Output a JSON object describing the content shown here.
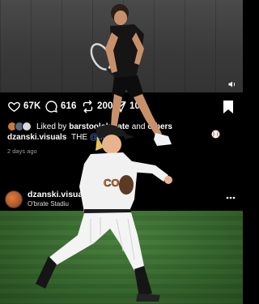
{
  "post_top": {
    "stats": {
      "likes": "67K",
      "comments": "616",
      "reposts": "200",
      "shares": "104"
    },
    "liked_by": {
      "prefix": "Liked by",
      "user": "barstoolokstate",
      "connector": "and",
      "others": "others"
    },
    "caption": {
      "username": "dzanski.visuals",
      "text": "THE",
      "mention": "@der"
    },
    "timestamp": "2 days ago"
  },
  "post_next": {
    "username": "dzanski.visua",
    "location": "O'brate Stadiu"
  },
  "icons": {
    "heart": "heart-icon",
    "comment": "comment-icon",
    "repost": "repost-icon",
    "share": "send-icon",
    "bookmark": "bookmark-icon",
    "mute": "speaker-icon",
    "more": "more-icon"
  },
  "colors": {
    "background": "#000000",
    "mention": "#4b83d8",
    "muted_text": "#9b9b9b"
  }
}
